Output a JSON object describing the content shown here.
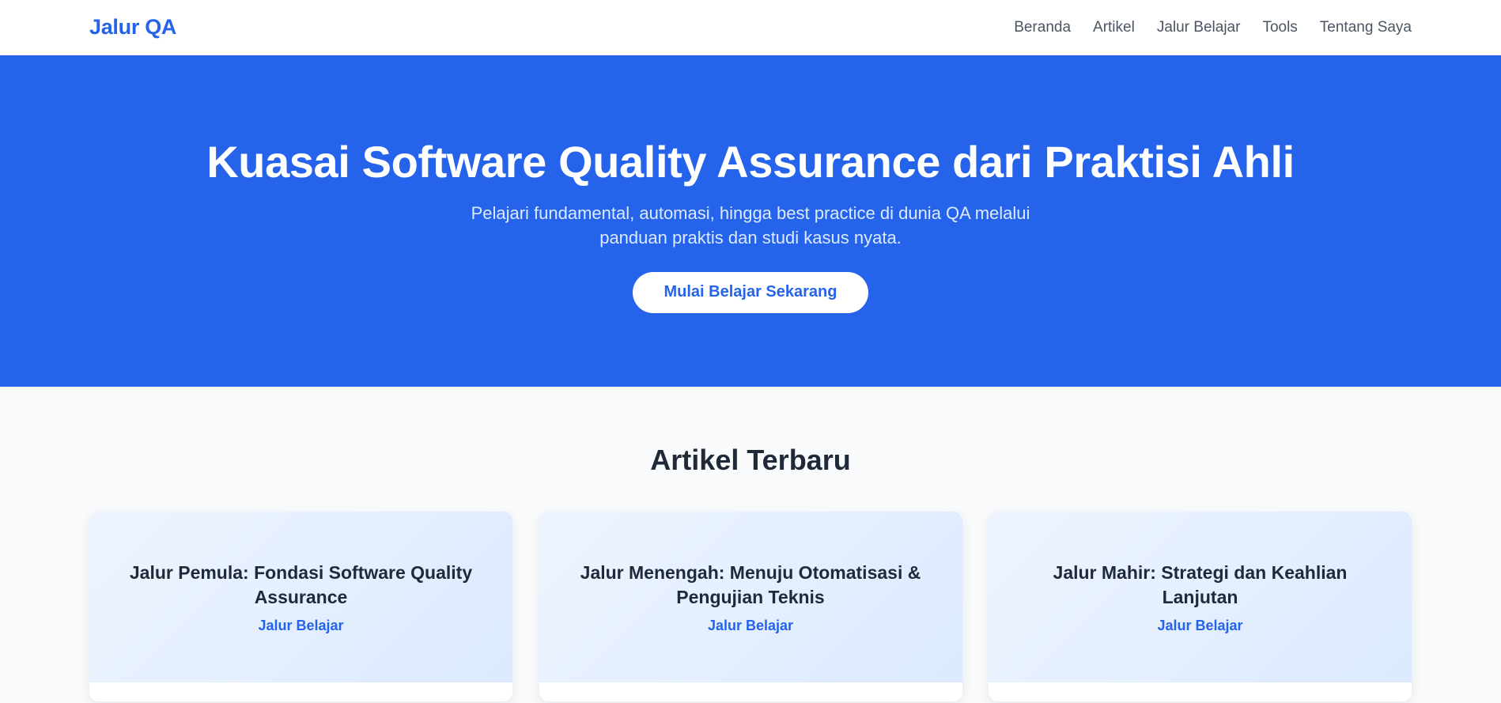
{
  "nav": {
    "logo": "Jalur QA",
    "links": [
      "Beranda",
      "Artikel",
      "Jalur Belajar",
      "Tools",
      "Tentang Saya"
    ]
  },
  "hero": {
    "title": "Kuasai Software Quality Assurance dari Praktisi Ahli",
    "subtitle": "Pelajari fundamental, automasi, hingga best practice di dunia QA melalui panduan praktis dan studi kasus nyata.",
    "cta": "Mulai Belajar Sekarang"
  },
  "articles": {
    "title": "Artikel Terbaru",
    "cards": [
      {
        "title": "Jalur Pemula: Fondasi Software Quality Assurance",
        "tag": "Jalur Belajar"
      },
      {
        "title": "Jalur Menengah: Menuju Otomatisasi & Pengujian Teknis",
        "tag": "Jalur Belajar"
      },
      {
        "title": "Jalur Mahir: Strategi dan Keahlian Lanjutan",
        "tag": "Jalur Belajar"
      }
    ]
  },
  "colors": {
    "primary": "#2563eb",
    "text_dark": "#1f2937",
    "nav_text": "#4b5563",
    "hero_subtitle": "#dbeafe",
    "section_bg": "#f8fafc"
  }
}
